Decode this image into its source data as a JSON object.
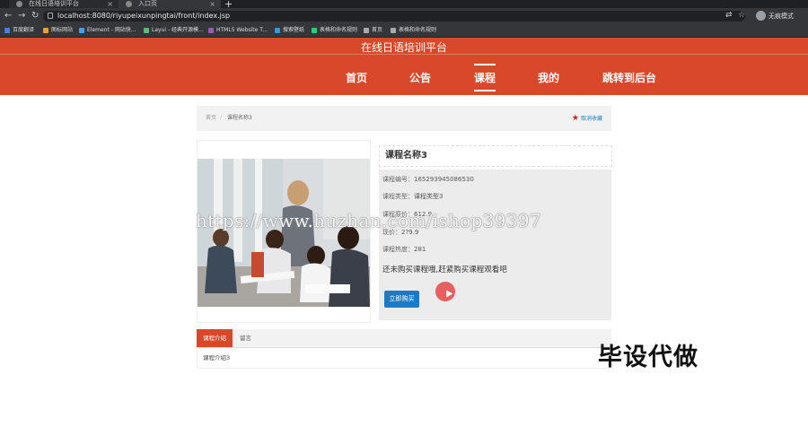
{
  "browser": {
    "tabs": [
      {
        "label": "在线日语培训平台"
      },
      {
        "label": "入口页"
      }
    ],
    "url": "localhost:8080/riyupeixunpingtai/front/index.jsp",
    "profile_label": "无痕模式",
    "bookmarks": [
      {
        "label": "百度翻译",
        "color": "#4a7cf0"
      },
      {
        "label": "图标网站",
        "color": "#f0a030"
      },
      {
        "label": "Element - 网站快...",
        "color": "#409eff"
      },
      {
        "label": "Layui - 经典开源模...",
        "color": "#5fb878"
      },
      {
        "label": "HTML5 Website T...",
        "color": "#9b59b6"
      },
      {
        "label": "搜索壁纸",
        "color": "#3498db"
      },
      {
        "label": "表格和命名规则",
        "color": "#2ecc71"
      },
      {
        "label": "首页",
        "color": "#aaaaaa"
      },
      {
        "label": "表格和命名规则",
        "color": "#aaaaaa"
      }
    ]
  },
  "site": {
    "title": "在线日语培训平台",
    "brand_color": "#d9482a",
    "nav": [
      {
        "label": "首页"
      },
      {
        "label": "公告"
      },
      {
        "label": "课程",
        "active": true
      },
      {
        "label": "我的"
      },
      {
        "label": "跳转到后台"
      }
    ]
  },
  "breadcrumb": {
    "home": "首页",
    "separator": "/",
    "current": "课程名称3"
  },
  "favorite_label": "取消收藏",
  "course": {
    "name": "课程名称3",
    "fields": [
      {
        "label": "课程编号：",
        "value": "1652939450865​30"
      },
      {
        "label": "课程类型：",
        "value": "课程类型3"
      },
      {
        "label": "课程原价：",
        "value": "612.9"
      },
      {
        "label": "现价：",
        "value": "2?9.9"
      },
      {
        "label": "课程热度：",
        "value": "281"
      }
    ],
    "notice": "还未购买课程哦,赶紧购买课程观看吧",
    "buy_label": "立即购买"
  },
  "tabs": [
    {
      "label": "课程介绍",
      "active": true
    },
    {
      "label": "留言"
    }
  ],
  "intro_text": "课程介绍3",
  "watermark": "https://www.huzhan.com/ishop39397",
  "corner_text": "毕设代做"
}
